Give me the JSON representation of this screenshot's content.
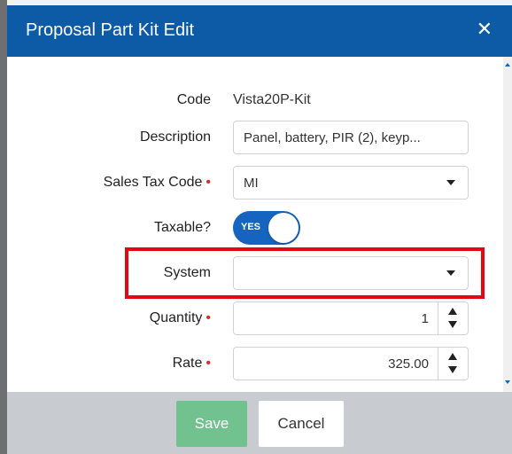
{
  "dialog": {
    "title": "Proposal Part Kit Edit",
    "close_icon": "close-icon"
  },
  "form": {
    "code": {
      "label": "Code",
      "value": "Vista20P-Kit"
    },
    "description": {
      "label": "Description",
      "value": "Panel, battery, PIR (2), keyp..."
    },
    "sales_tax_code": {
      "label": "Sales Tax Code",
      "required": true,
      "value": "MI"
    },
    "taxable": {
      "label": "Taxable?",
      "value": "YES",
      "on": true
    },
    "system": {
      "label": "System",
      "value": ""
    },
    "quantity": {
      "label": "Quantity",
      "required": true,
      "value": "1"
    },
    "rate": {
      "label": "Rate",
      "required": true,
      "value": "325.00"
    }
  },
  "buttons": {
    "save": "Save",
    "cancel": "Cancel"
  },
  "colors": {
    "titlebar": "#0d5aa6",
    "toggle_on": "#1565c0",
    "required": "#d62c2c",
    "highlight": "#e30613",
    "save": "#72c28f"
  },
  "required_mark": "•"
}
